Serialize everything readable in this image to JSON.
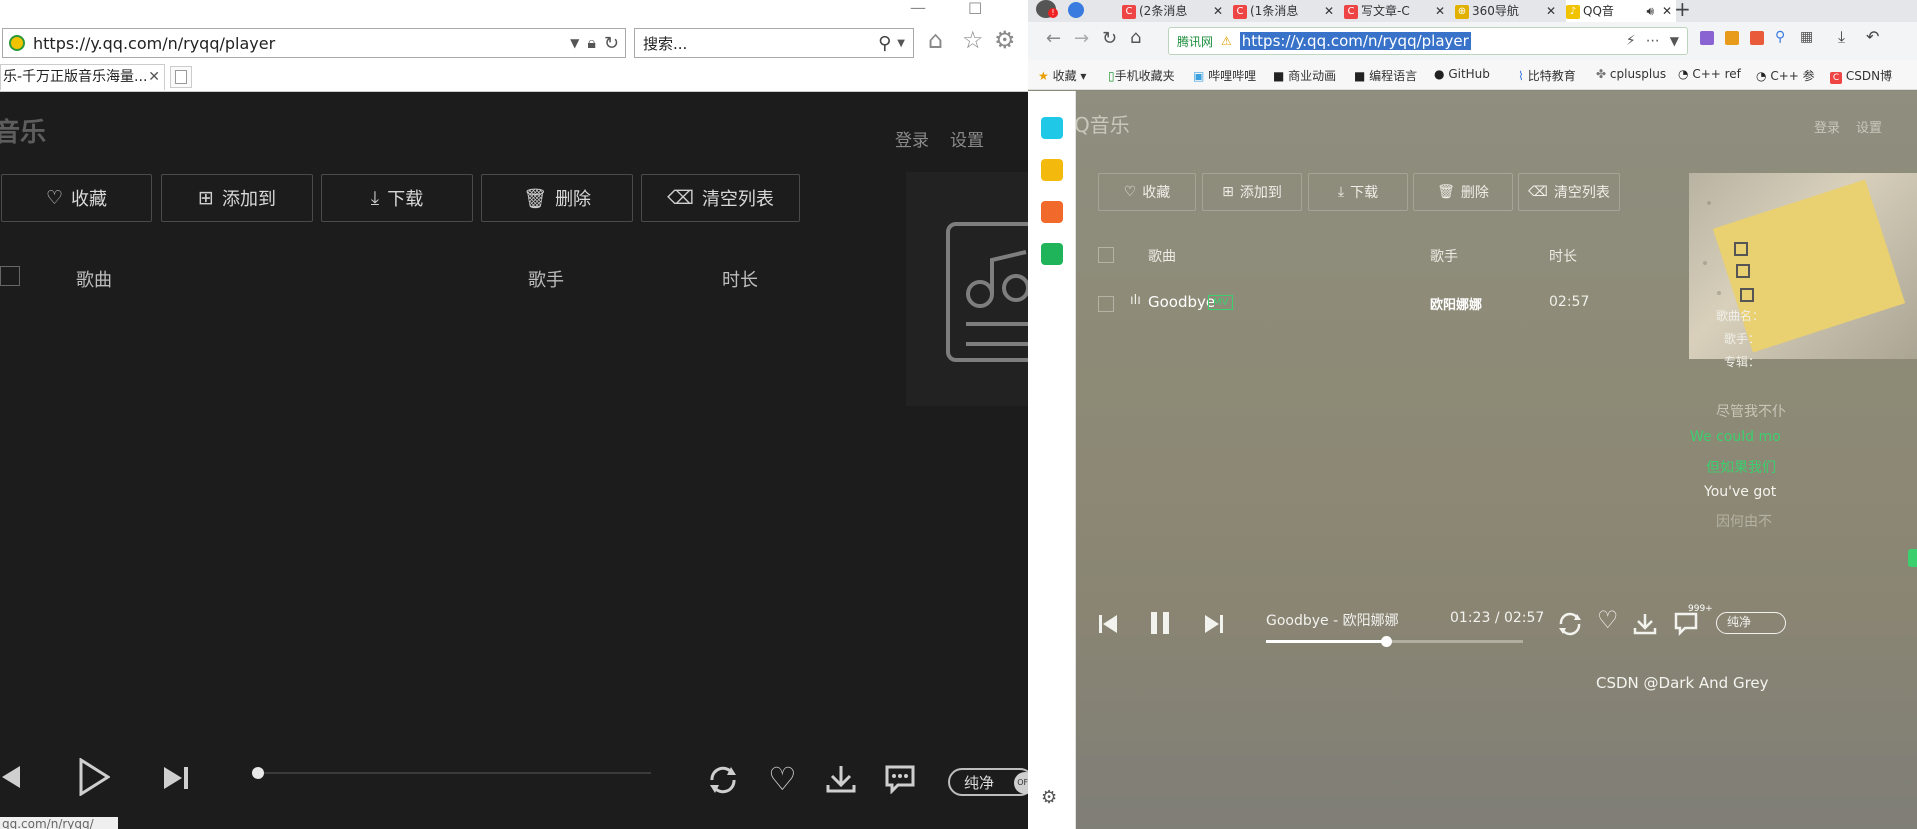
{
  "left": {
    "address": "https://y.qq.com/n/ryqq/player",
    "search_placeholder": "搜索...",
    "tab_title": "乐-千万正版音乐海量...",
    "brand_partial": "音乐",
    "login": "登录",
    "settings": "设置",
    "buttons": [
      "收藏",
      "添加到",
      "下载",
      "删除",
      "清空列表"
    ],
    "columns": [
      "歌曲",
      "歌手",
      "时长"
    ],
    "progress": 0,
    "pure_label": "纯净",
    "pure_state": "OFF",
    "status_url": "qq.com/n/ryqq/"
  },
  "right": {
    "tabs": [
      "(2条消息",
      "(1条消息",
      "写文章-C",
      "360导航",
      "QQ音"
    ],
    "address": "https://y.qq.com/n/ryqq/player",
    "secure_label": "腾讯网",
    "bookmarks": [
      "收藏",
      "手机收藏夹",
      "哔哩哔哩",
      "商业动画",
      "编程语言",
      "GitHub",
      "比特教育",
      "cplusplus",
      "C++ ref",
      "C++ 参",
      "CSDN博"
    ],
    "brand_partial": "Q音乐",
    "login": "登录",
    "settings": "设置",
    "buttons": [
      "收藏",
      "添加到",
      "下载",
      "删除",
      "清空列表"
    ],
    "columns": [
      "歌曲",
      "歌手",
      "时长"
    ],
    "song": {
      "title": "Goodbye",
      "mv": "MV",
      "artist": "欧阳娜娜",
      "duration": "02:57"
    },
    "info": {
      "name_label": "歌曲名：",
      "artist_label": "歌手：",
      "album_label": "专辑："
    },
    "lyrics": [
      "尽管我不仆",
      "We could mo",
      "但如果我们",
      "You've got",
      "因何由不"
    ],
    "now_playing": "Goodbye - 欧阳娜娜",
    "time_current": "01:23",
    "time_sep": "/",
    "time_total": "02:57",
    "progress": 0.468,
    "comment_badge": "999+",
    "pure_label": "纯净",
    "watermark": "CSDN @Dark And Grey"
  }
}
